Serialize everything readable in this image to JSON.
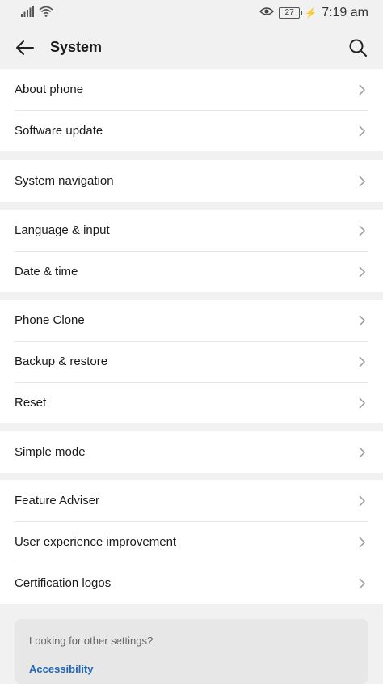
{
  "status_bar": {
    "signal_icon": "signal-icon",
    "wifi_icon": "wifi-icon",
    "eye_icon": "eye-comfort-icon",
    "battery_level": "27",
    "time": "7:19 am"
  },
  "header": {
    "title": "System",
    "back_icon": "arrow-back-icon",
    "search_icon": "search-icon"
  },
  "groups": [
    {
      "items": [
        "About phone",
        "Software update"
      ]
    },
    {
      "items": [
        "System navigation"
      ]
    },
    {
      "items": [
        "Language & input",
        "Date & time"
      ]
    },
    {
      "items": [
        "Phone Clone",
        "Backup & restore",
        "Reset"
      ]
    },
    {
      "items": [
        "Simple mode"
      ]
    },
    {
      "items": [
        "Feature Adviser",
        "User experience improvement",
        "Certification logos"
      ]
    }
  ],
  "suggestion": {
    "question": "Looking for other settings?",
    "link": "Accessibility"
  },
  "colors": {
    "background": "#f1f1f1",
    "row_background": "#ffffff",
    "link": "#1f67b7"
  }
}
